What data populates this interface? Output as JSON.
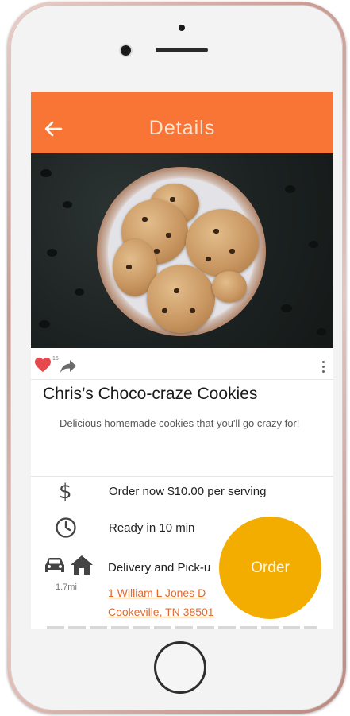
{
  "app_bar": {
    "title": "Details"
  },
  "actions": {
    "like_count": "15"
  },
  "item": {
    "title": "Chris’s Choco-craze Cookies",
    "description": "Delicious homemade cookies that you'll go crazy for!"
  },
  "details": {
    "price_text": "Order now $10.00 per serving",
    "ready_text": "Ready in 10 min",
    "delivery_text": "Delivery and Pick-u",
    "distance": "1.7mi",
    "address_line1": "1 William L Jones D",
    "address_line2": "Cookeville, TN 38501"
  },
  "order_button": {
    "label": "Order"
  },
  "colors": {
    "app_bar": "#f97535",
    "order_button": "#f2ad00",
    "link": "#e06a30",
    "heart": "#e5484d"
  },
  "icons": [
    "back-arrow-icon",
    "heart-icon",
    "share-icon",
    "more-vert-icon",
    "dollar-icon",
    "clock-icon",
    "car-icon",
    "house-icon"
  ]
}
